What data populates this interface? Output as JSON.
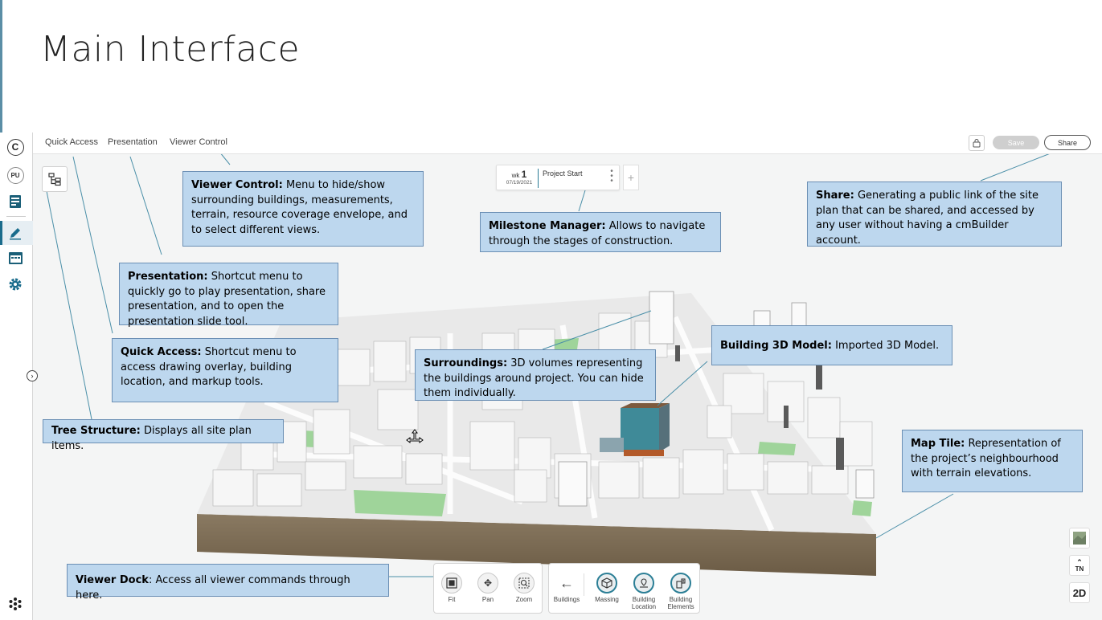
{
  "slide": {
    "title": "Main Interface"
  },
  "left_rail": {
    "logo_letter": "C",
    "user_initials": "PU",
    "icons": [
      "cm-logo-icon",
      "user-avatar",
      "document-icon",
      "pencil-icon",
      "calendar-icon",
      "gear-icon",
      "apps-icon"
    ]
  },
  "menubar": {
    "items": [
      "Quick Access",
      "Presentation",
      "Viewer Control"
    ],
    "save_label": "Save",
    "share_label": "Share"
  },
  "milestone": {
    "week_label": "wk",
    "week_number": "1",
    "date": "07/19/2021",
    "name": "Project Start",
    "add_label": "+"
  },
  "right_tools": {
    "north_label": "TN",
    "view_mode": "2D"
  },
  "dock": {
    "view_items": [
      "Fit",
      "Pan",
      "Zoom"
    ],
    "building_items": [
      "Buildings",
      "Massing",
      "Building Location",
      "Building Elements"
    ],
    "building_location_lines": [
      "Building",
      "Location"
    ],
    "building_elements_lines": [
      "Building",
      "Elements"
    ]
  },
  "callouts": {
    "viewer_control": {
      "title": "Viewer Control:",
      "text": " Menu to hide/show surrounding buildings, measurements, terrain, resource coverage envelope, and to select different views."
    },
    "milestone_manager": {
      "title": "Milestone Manager:",
      "text": " Allows to navigate through the stages of construction."
    },
    "share": {
      "title": "Share:",
      "text": " Generating a public link of the site plan that can be shared, and accessed by any user without having a cmBuilder account."
    },
    "presentation": {
      "title": "Presentation:",
      "text": " Shortcut menu to quickly go to play presentation, share presentation, and to open the presentation slide tool."
    },
    "quick_access": {
      "title": "Quick Access:",
      "text": " Shortcut menu to access drawing overlay, building location, and markup tools."
    },
    "surroundings": {
      "title": "Surroundings:",
      "text": " 3D volumes representing the buildings around project. You can hide them individually."
    },
    "building_model": {
      "title": "Building 3D Model:",
      "text": " Imported 3D Model."
    },
    "tree_structure": {
      "title": "Tree Structure:",
      "text": " Displays all site plan items."
    },
    "map_tile": {
      "title": "Map Tile:",
      "text": " Representation of the project’s neighbourhood with terrain elevations."
    },
    "viewer_dock": {
      "title": "Viewer Dock",
      "text": ": Access all viewer commands through here."
    }
  },
  "colors": {
    "callout_fill": "#bdd7ee",
    "callout_border": "#6b8fb4",
    "accent_teal": "#2c7f96",
    "leader_line": "#4a8fa8"
  }
}
